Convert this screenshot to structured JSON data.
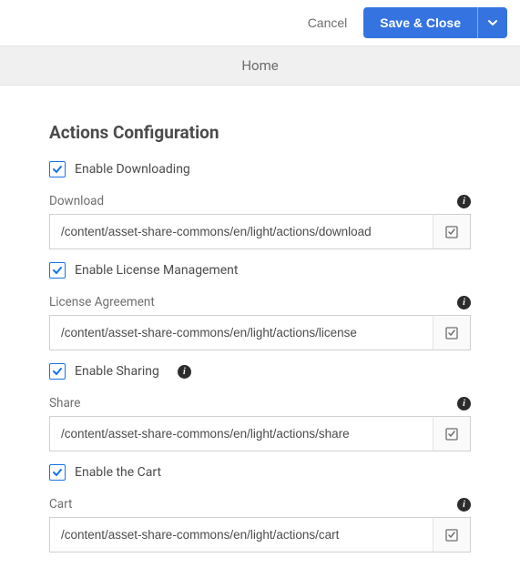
{
  "toolbar": {
    "cancel": "Cancel",
    "save": "Save & Close"
  },
  "breadcrumb": {
    "title": "Home"
  },
  "section": {
    "title": "Actions Configuration"
  },
  "download": {
    "enable_label": "Enable Downloading",
    "field_label": "Download",
    "value": "/content/asset-share-commons/en/light/actions/download"
  },
  "license": {
    "enable_label": "Enable License Management",
    "field_label": "License Agreement",
    "value": "/content/asset-share-commons/en/light/actions/license"
  },
  "share": {
    "enable_label": "Enable Sharing",
    "field_label": "Share",
    "value": "/content/asset-share-commons/en/light/actions/share"
  },
  "cart": {
    "enable_label": "Enable the Cart",
    "field_label": "Cart",
    "value": "/content/asset-share-commons/en/light/actions/cart"
  }
}
